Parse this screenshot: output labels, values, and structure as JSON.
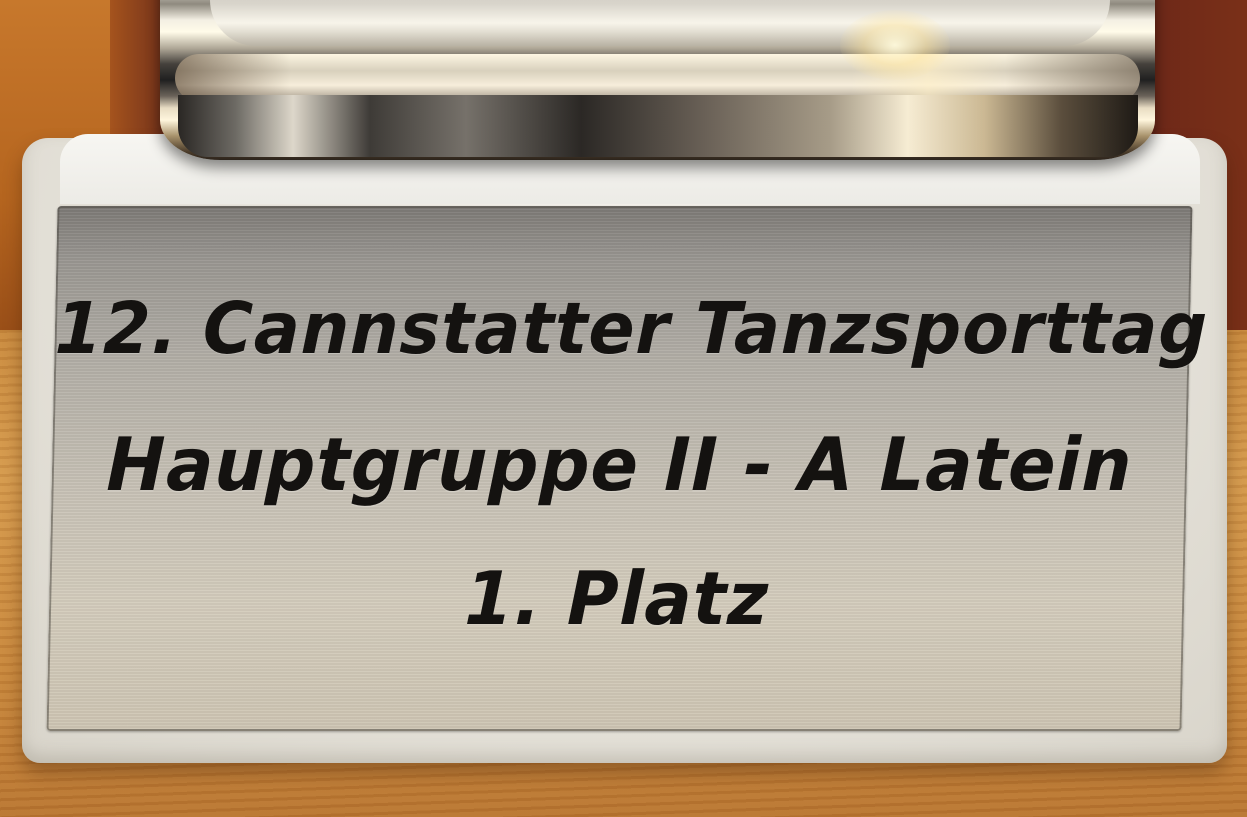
{
  "plaque": {
    "line_1": "12. Cannstatter Tanzsporttag",
    "line_2": "Hauptgruppe II - A Latein",
    "line_3": "1. Platz"
  }
}
